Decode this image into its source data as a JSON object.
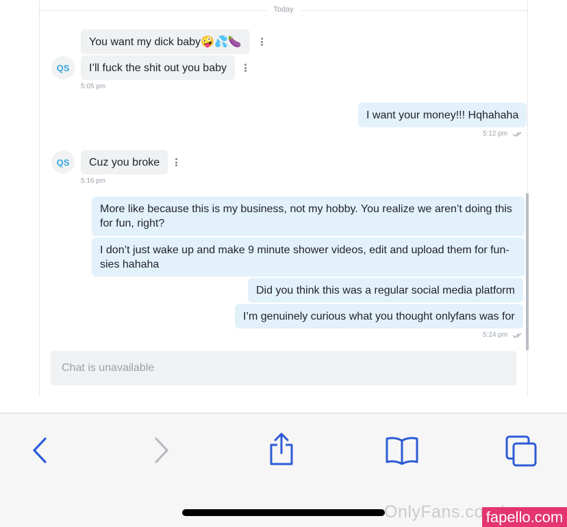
{
  "day_separator": "Today",
  "messages": [
    {
      "text": "You want my dick baby🤪💦🍆",
      "direction": "incoming"
    },
    {
      "text": "I’ll fuck the shit out you baby",
      "direction": "incoming"
    },
    {
      "text": "I want your money!!! Hqhahaha",
      "direction": "outgoing"
    },
    {
      "text": "Cuz you broke",
      "direction": "incoming"
    },
    {
      "text": "More like because this is my business, not my hobby. You realize we aren’t doing this for fun, right?",
      "direction": "outgoing"
    },
    {
      "text": "I don’t just wake up and make 9 minute shower videos, edit and upload them for fun-sies hahaha",
      "direction": "outgoing"
    },
    {
      "text": "Did you think this was a regular social media platform",
      "direction": "outgoing"
    },
    {
      "text": "I’m genuinely curious what you thought onlyfans was for",
      "direction": "outgoing"
    }
  ],
  "avatars": {
    "initials": "QS"
  },
  "timestamps": [
    "5:05 pm",
    "5:12 pm",
    "5:16 pm",
    "5:24 pm"
  ],
  "chat_input": {
    "placeholder": "Chat is unavailable"
  },
  "colors": {
    "incoming_bubble": "#eff1f2",
    "outgoing_bubble": "#e3f1fb",
    "avatar_text": "#3aa6dd",
    "toolbar_icon": "#2c5bd6",
    "toolbar_icon_disabled": "#b8bcc2"
  },
  "browser_toolbar": {
    "icons": [
      "back-arrow-icon",
      "forward-arrow-icon",
      "share-icon",
      "bookmarks-book-icon",
      "tabs-icon"
    ]
  },
  "watermarks": {
    "source": "OnlyFans.com/ ...",
    "site": "fapello.com"
  }
}
